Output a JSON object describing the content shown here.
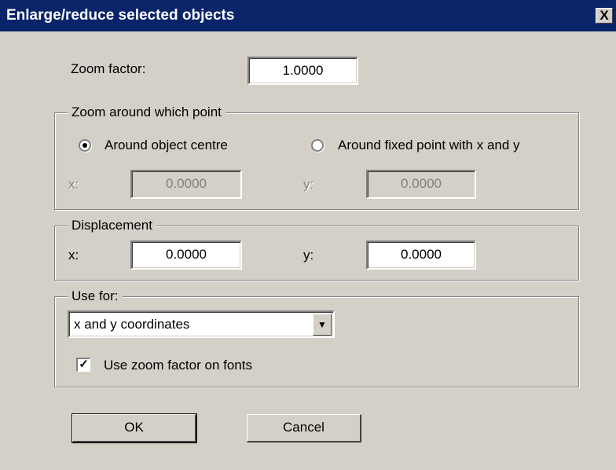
{
  "window": {
    "title": "Enlarge/reduce selected objects",
    "close_label": "X"
  },
  "zoom_factor": {
    "label": "Zoom factor:",
    "value": "1.0000"
  },
  "zoom_point": {
    "legend": "Zoom around which point",
    "option_centre": "Around object centre",
    "option_fixed": "Around fixed point with x and y",
    "selected": "option_centre",
    "x_label": "x:",
    "x_value": "0.0000",
    "y_label": "y:",
    "y_value": "0.0000"
  },
  "displacement": {
    "legend": "Displacement",
    "x_label": "x:",
    "x_value": "0.0000",
    "y_label": "y:",
    "y_value": "0.0000"
  },
  "use_for": {
    "legend": "Use for:",
    "selected": "x and y coordinates",
    "fonts_label": "Use zoom factor on fonts",
    "fonts_checked": true
  },
  "buttons": {
    "ok": "OK",
    "cancel": "Cancel"
  }
}
